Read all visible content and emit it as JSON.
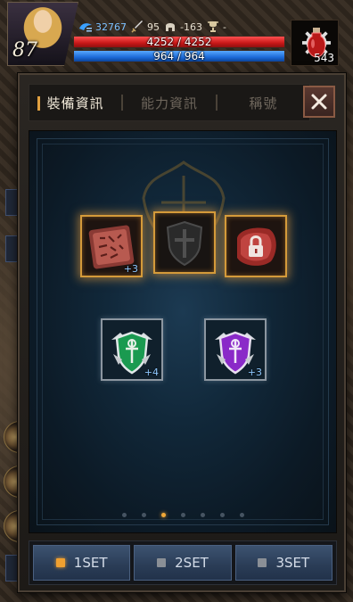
{
  "hud": {
    "level": "87",
    "exp_value": "32767",
    "attack_value": "95",
    "defense_value": "-163",
    "trophy_value": "-",
    "hp_text": "4252 / 4252",
    "mp_text": "964 / 964",
    "hp_fill": 1.0,
    "mp_fill": 1.0,
    "potion_count": "543"
  },
  "panel": {
    "tabs": [
      {
        "label": "裝備資訊",
        "active": true
      },
      {
        "label": "能力資訊",
        "active": false
      },
      {
        "label": "稱號",
        "active": false
      }
    ],
    "close_icon": "close-icon",
    "slots_top": [
      {
        "icon": "rune-tablet-icon",
        "enhance": "+3",
        "frame": "gold"
      },
      {
        "icon": "empty-shield-icon",
        "enhance": "",
        "frame": "gold"
      },
      {
        "icon": "locked-slot-icon",
        "enhance": "",
        "frame": "gold"
      }
    ],
    "slots_bottom": [
      {
        "icon": "green-crest-emblem-icon",
        "enhance": "+4",
        "frame": "steel"
      },
      {
        "icon": "purple-crest-emblem-icon",
        "enhance": "+3",
        "frame": "steel"
      }
    ],
    "page_count": 7,
    "active_page": 3,
    "sets": [
      {
        "label": "1SET",
        "active": true
      },
      {
        "label": "2SET",
        "active": false
      },
      {
        "label": "3SET",
        "active": false
      }
    ]
  },
  "colors": {
    "accent": "#f0a030",
    "hp": "#c81818",
    "mp": "#1c6ad8",
    "gold_frame": "#d49a3a"
  }
}
